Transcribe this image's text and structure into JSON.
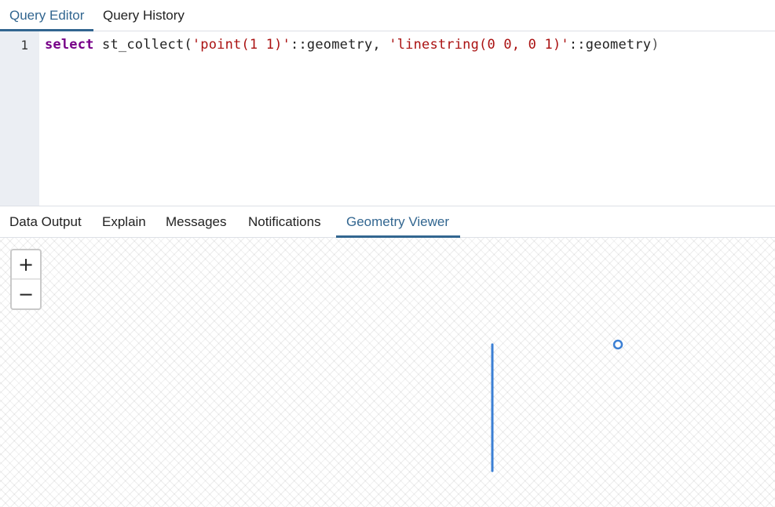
{
  "top_tabs": [
    {
      "label": "Query Editor",
      "active": true
    },
    {
      "label": "Query History",
      "active": false
    }
  ],
  "editor": {
    "line_number": "1",
    "tokens": {
      "kw": "select",
      "fn": " st_collect(",
      "str1": "'point(1 1)'",
      "cast1": "::geometry, ",
      "str2": "'linestring(0 0, 0 1)'",
      "cast2": "::geometry",
      "close": ")"
    }
  },
  "bottom_tabs": [
    {
      "label": "Data Output",
      "active": false
    },
    {
      "label": "Explain",
      "active": false
    },
    {
      "label": "Messages",
      "active": false
    },
    {
      "label": "Notifications",
      "active": false
    },
    {
      "label": "Geometry Viewer",
      "active": true
    }
  ],
  "map": {
    "zoom_in_label": "+",
    "zoom_out_label": "−",
    "feature_color": "#3b7fd4",
    "geometries": [
      {
        "type": "point",
        "coords": [
          1,
          1
        ]
      },
      {
        "type": "linestring",
        "coords": [
          [
            0,
            0
          ],
          [
            0,
            1
          ]
        ]
      }
    ]
  }
}
